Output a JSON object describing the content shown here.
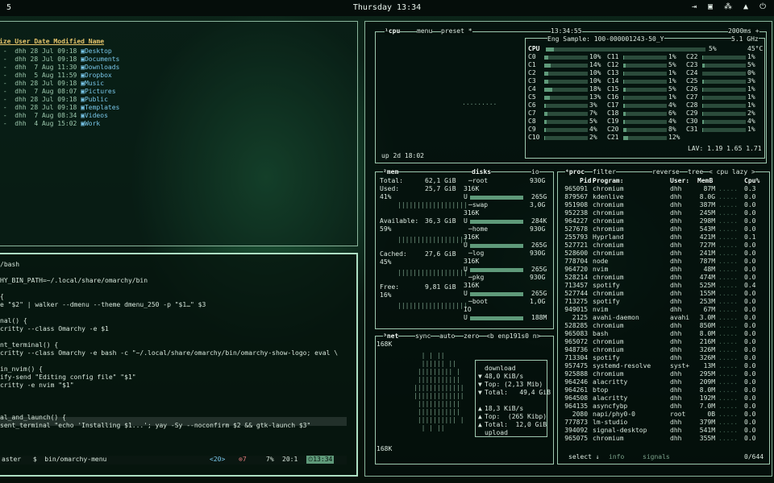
{
  "topbar": {
    "workspace": "5",
    "clock": "Thursday 13:34"
  },
  "files": {
    "header": "ize User Date Modified Name",
    "rows": [
      {
        "size": " -",
        "user": "dhh",
        "date": "28 Jul 09:18",
        "name": "Desktop"
      },
      {
        "size": " -",
        "user": "dhh",
        "date": "28 Jul 09:18",
        "name": "Documents"
      },
      {
        "size": " -",
        "user": "dhh",
        "date": " 7 Aug 11:30",
        "name": "Downloads"
      },
      {
        "size": " -",
        "user": "dhh",
        "date": " 5 Aug 11:59",
        "name": "Dropbox"
      },
      {
        "size": " -",
        "user": "dhh",
        "date": "28 Jul 09:18",
        "name": "Music"
      },
      {
        "size": " -",
        "user": "dhh",
        "date": " 7 Aug 08:07",
        "name": "Pictures"
      },
      {
        "size": " -",
        "user": "dhh",
        "date": "28 Jul 09:18",
        "name": "Public"
      },
      {
        "size": " -",
        "user": "dhh",
        "date": "28 Jul 09:18",
        "name": "Templates"
      },
      {
        "size": " -",
        "user": "dhh",
        "date": " 7 Aug 08:34",
        "name": "Videos"
      },
      {
        "size": " -",
        "user": "dhh",
        "date": " 4 Aug 15:02",
        "name": "Work"
      }
    ]
  },
  "editor": {
    "lines": [
      "/bash",
      "",
      "HY_BIN_PATH=~/.local/share/omarchy/bin",
      "",
      "{",
      "e \"$2\" | walker --dmenu --theme dmenu_250 -p \"$1…\" $3",
      "",
      "nal() {",
      "critty --class Omarchy -e $1",
      "",
      "nt_terminal() {",
      "critty --class Omarchy -e bash -c \"~/.local/share/omarchy/bin/omarchy-show-logo; eval \\",
      "",
      "in_nvim() {",
      "ify-send \"Editing config file\" \"$1\"",
      "critty -e nvim \"$1\"",
      "",
      "",
      "",
      "al_and_launch() {",
      "sent_terminal \"echo 'Installing $1...'; yay -Sy --noconfirm $2 && gtk-launch $3\""
    ],
    "status": {
      "branch": "aster",
      "file": "bin/omarchy-menu",
      "count": "<20>",
      "errors": "7",
      "pct": "7%",
      "pos": "20:1",
      "time": "13:34"
    }
  },
  "btop": {
    "cpu": {
      "title": "¹cpu",
      "menu": "menu",
      "preset": "preset *",
      "clock": "13:34:55",
      "interval": "2000ms +",
      "model": "Eng Sample: 100-000001243-50_Y",
      "freq": "5.1 GHz",
      "total": {
        "label": "CPU",
        "pct": "5%",
        "temp": "45°C",
        "value": 5
      },
      "uptime": "up 2d 18:02",
      "lav": "LAV: 1.19 1.65 1.71",
      "cores": [
        {
          "n": "C0",
          "p": "10%",
          "v": 10
        },
        {
          "n": "C1",
          "p": "14%",
          "v": 14
        },
        {
          "n": "C2",
          "p": "10%",
          "v": 10
        },
        {
          "n": "C3",
          "p": "10%",
          "v": 10
        },
        {
          "n": "C4",
          "p": "18%",
          "v": 18
        },
        {
          "n": "C5",
          "p": "13%",
          "v": 13
        },
        {
          "n": "C6",
          "p": "3%",
          "v": 3
        },
        {
          "n": "C7",
          "p": "7%",
          "v": 7
        },
        {
          "n": "C8",
          "p": "5%",
          "v": 5
        },
        {
          "n": "C9",
          "p": "4%",
          "v": 4
        },
        {
          "n": "C10",
          "p": "2%",
          "v": 2
        },
        {
          "n": "C11",
          "p": "1%",
          "v": 1
        },
        {
          "n": "C12",
          "p": "5%",
          "v": 5
        },
        {
          "n": "C13",
          "p": "1%",
          "v": 1
        },
        {
          "n": "C14",
          "p": "1%",
          "v": 1
        },
        {
          "n": "C15",
          "p": "5%",
          "v": 5
        },
        {
          "n": "C16",
          "p": "1%",
          "v": 1
        },
        {
          "n": "C17",
          "p": "4%",
          "v": 4
        },
        {
          "n": "C18",
          "p": "6%",
          "v": 6
        },
        {
          "n": "C19",
          "p": "4%",
          "v": 4
        },
        {
          "n": "C20",
          "p": "8%",
          "v": 8
        },
        {
          "n": "C21",
          "p": "12%",
          "v": 12
        },
        {
          "n": "C22",
          "p": "1%",
          "v": 1
        },
        {
          "n": "C23",
          "p": "5%",
          "v": 5
        },
        {
          "n": "C24",
          "p": "0%",
          "v": 0
        },
        {
          "n": "C25",
          "p": "3%",
          "v": 3
        },
        {
          "n": "C26",
          "p": "1%",
          "v": 1
        },
        {
          "n": "C27",
          "p": "1%",
          "v": 1
        },
        {
          "n": "C28",
          "p": "1%",
          "v": 1
        },
        {
          "n": "C29",
          "p": "2%",
          "v": 2
        },
        {
          "n": "C30",
          "p": "4%",
          "v": 4
        },
        {
          "n": "C31",
          "p": "1%",
          "v": 1
        }
      ]
    },
    "mem": {
      "title": "²mem",
      "disks": "disks",
      "io": "io",
      "total_l": "Total:",
      "total_v": "62,1 GiB",
      "used_l": "Used:",
      "used_v": "25,7 GiB",
      "used_p": "41%",
      "avail_l": "Available:",
      "avail_v": "36,3 GiB",
      "avail_p": "59%",
      "cached_l": "Cached:",
      "cached_v": "27,6 GiB",
      "cached_p": "45%",
      "free_l": "Free:",
      "free_v": "9,81 GiB",
      "free_p": "16%",
      "disks_list": [
        {
          "name": "root",
          "size": "930G",
          "io": "316K",
          "used": "265G"
        },
        {
          "name": "swap",
          "size": "3,0G",
          "io": "316K",
          "used": "284K"
        },
        {
          "name": "home",
          "size": "930G",
          "io": "316K",
          "used": "265G"
        },
        {
          "name": "log",
          "size": "930G",
          "io": "316K",
          "used": "265G"
        },
        {
          "name": "pkg",
          "size": "930G",
          "io": "316K",
          "used": "265G"
        },
        {
          "name": "boot",
          "size": "1,0G",
          "io": "IO",
          "used": "188M"
        }
      ]
    },
    "net": {
      "title": "³net",
      "sync": "sync",
      "auto": "auto",
      "zero": "zero",
      "iface": "<b enp191s0 n>",
      "scale_top": "168K",
      "scale_bottom": "168K",
      "dl_l": "download",
      "dl_v": "48,0 KiB/s",
      "dl_top": "Top: (2,13 Mib)",
      "dl_total": "Total:   49,4 GiB",
      "ul_v": "18,3 KiB/s",
      "ul_top": "Top:  (265 Kibp)",
      "ul_total": "Total:  12,0 GiB",
      "ul_l": "upload"
    },
    "proc": {
      "title": "⁴proc",
      "filter": "filter",
      "reverse": "reverse",
      "tree": "tree",
      "cpu_lazy": "< cpu lazy >",
      "headers": {
        "pid": "Pid:",
        "prog": "Program:",
        "user": "User:",
        "mem": "MemB",
        "cpu": "Cpu%"
      },
      "rows": [
        {
          "pid": "965091",
          "prog": "chromium",
          "user": "dhh",
          "mem": "87M",
          "cpu": "0.3"
        },
        {
          "pid": "879567",
          "prog": "kdenlive",
          "user": "dhh",
          "mem": "8.0G",
          "cpu": "0.0"
        },
        {
          "pid": "951908",
          "prog": "chromium",
          "user": "dhh",
          "mem": "387M",
          "cpu": "0.0"
        },
        {
          "pid": "952238",
          "prog": "chromium",
          "user": "dhh",
          "mem": "245M",
          "cpu": "0.0"
        },
        {
          "pid": "964227",
          "prog": "chromium",
          "user": "dhh",
          "mem": "298M",
          "cpu": "0.0"
        },
        {
          "pid": "527678",
          "prog": "chromium",
          "user": "dhh",
          "mem": "543M",
          "cpu": "0.0"
        },
        {
          "pid": "255793",
          "prog": "Hyprland",
          "user": "dhh",
          "mem": "421M",
          "cpu": "0.1"
        },
        {
          "pid": "527721",
          "prog": "chromium",
          "user": "dhh",
          "mem": "727M",
          "cpu": "0.0"
        },
        {
          "pid": "528600",
          "prog": "chromium",
          "user": "dhh",
          "mem": "241M",
          "cpu": "0.0"
        },
        {
          "pid": "778704",
          "prog": "node",
          "user": "dhh",
          "mem": "787M",
          "cpu": "0.0"
        },
        {
          "pid": "964720",
          "prog": "nvim",
          "user": "dhh",
          "mem": "48M",
          "cpu": "0.0"
        },
        {
          "pid": "528214",
          "prog": "chromium",
          "user": "dhh",
          "mem": "474M",
          "cpu": "0.0"
        },
        {
          "pid": "713457",
          "prog": "spotify",
          "user": "dhh",
          "mem": "525M",
          "cpu": "0.4"
        },
        {
          "pid": "527744",
          "prog": "chromium",
          "user": "dhh",
          "mem": "155M",
          "cpu": "0.0"
        },
        {
          "pid": "713275",
          "prog": "spotify",
          "user": "dhh",
          "mem": "253M",
          "cpu": "0.0"
        },
        {
          "pid": "949015",
          "prog": "nvim",
          "user": "dhh",
          "mem": "67M",
          "cpu": "0.0"
        },
        {
          "pid": "2125",
          "prog": "avahi-daemon",
          "user": "avahi",
          "mem": "3.0M",
          "cpu": "0.0"
        },
        {
          "pid": "528285",
          "prog": "chromium",
          "user": "dhh",
          "mem": "850M",
          "cpu": "0.0"
        },
        {
          "pid": "965083",
          "prog": "bash",
          "user": "dhh",
          "mem": "8.0M",
          "cpu": "0.0"
        },
        {
          "pid": "965072",
          "prog": "chromium",
          "user": "dhh",
          "mem": "216M",
          "cpu": "0.0"
        },
        {
          "pid": "948736",
          "prog": "chromium",
          "user": "dhh",
          "mem": "326M",
          "cpu": "0.0"
        },
        {
          "pid": "713304",
          "prog": "spotify",
          "user": "dhh",
          "mem": "326M",
          "cpu": "0.0"
        },
        {
          "pid": "957475",
          "prog": "systemd-resolve",
          "user": "syst+",
          "mem": "13M",
          "cpu": "0.0"
        },
        {
          "pid": "925888",
          "prog": "chromium",
          "user": "dhh",
          "mem": "295M",
          "cpu": "0.0"
        },
        {
          "pid": "964246",
          "prog": "alacritty",
          "user": "dhh",
          "mem": "209M",
          "cpu": "0.0"
        },
        {
          "pid": "964261",
          "prog": "btop",
          "user": "dhh",
          "mem": "8.0M",
          "cpu": "0.0"
        },
        {
          "pid": "964508",
          "prog": "alacritty",
          "user": "dhh",
          "mem": "192M",
          "cpu": "0.0"
        },
        {
          "pid": "964135",
          "prog": "asyncfybp",
          "user": "dhh",
          "mem": "7.0M",
          "cpu": "0.0"
        },
        {
          "pid": "2080",
          "prog": "napi/phy0-0",
          "user": "root",
          "mem": "0B",
          "cpu": "0.0"
        },
        {
          "pid": "777873",
          "prog": "lm-studio",
          "user": "dhh",
          "mem": "379M",
          "cpu": "0.0"
        },
        {
          "pid": "394092",
          "prog": "signal-desktop",
          "user": "dhh",
          "mem": "541M",
          "cpu": "0.0"
        },
        {
          "pid": "965075",
          "prog": "chromium",
          "user": "dhh",
          "mem": "355M",
          "cpu": "0.0"
        }
      ],
      "footer_select": "select ↓",
      "footer_info": "info",
      "footer_signals": "signals",
      "footer_count": "0/644"
    }
  }
}
